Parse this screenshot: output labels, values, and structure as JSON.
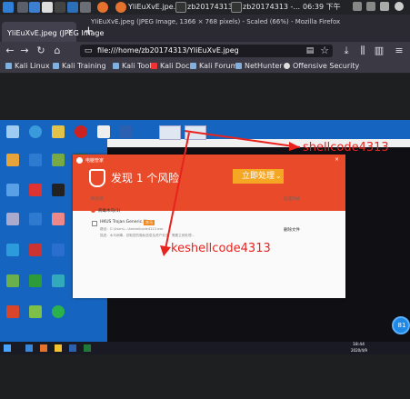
{
  "panel": {
    "tabs": [
      {
        "label": "YIiEuXvE.jpe...",
        "icon": "firefox-icon"
      },
      {
        "label": "zb20174313...",
        "icon": "terminal-icon"
      },
      {
        "label": "zb20174313 -...",
        "icon": "terminal-icon"
      }
    ],
    "clock": "06:39 下午"
  },
  "browser": {
    "window_title": "YIiEuXvE.jpeg (JPEG Image, 1366 × 768 pixels) - Scaled (66%) - Mozilla Firefox",
    "tab_label": "YIiEuXvE.jpeg (JPEG Image",
    "new_tab_symbol": "+",
    "url": "file:///home/zb20174313/YIiEuXvE.jpeg",
    "bookmarks": [
      "Kali Linux",
      "Kali Training",
      "Kali Tools",
      "Kali Docs",
      "Kali Forums",
      "NetHunter",
      "Offensive Security"
    ]
  },
  "screenshot": {
    "alert": {
      "app_title": "电脑管家",
      "heading": "发现 1 个风险",
      "action_button": "立即处理",
      "col_risk": "风险项",
      "col_action": "处理方式",
      "section": "病毒木马(1)",
      "file_name": "HKUS Trojan.Generic.Kiss",
      "file_tag": "木马",
      "path": "路径：C:\\Users\\...\\keshellcode4313.exe",
      "description": "描述：木马病毒，窃取您的隐私信息及资产安全，需要立即处理...",
      "row_action": "删除文件"
    },
    "annotations": [
      "shellcode4313",
      "keshellcode4313"
    ],
    "taskbar": {
      "time": "18:44",
      "date": "2020/4/9"
    },
    "zoom_badge": "81"
  },
  "colors": {
    "annotation_red": "#e8231e",
    "alert_red": "#e84a2a",
    "desktop_blue": "#1565c0"
  }
}
